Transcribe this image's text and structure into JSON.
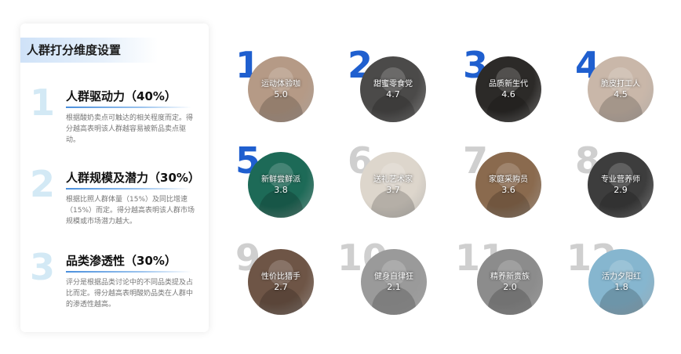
{
  "panel": {
    "title": "人群打分维度设置",
    "dimensions": [
      {
        "num": "1",
        "title": "人群驱动力（40%）",
        "desc": "根据酸奶卖点可触达的相关程度而定。得分越高表明该人群越容易被新品卖点驱动。"
      },
      {
        "num": "2",
        "title": "人群规模及潜力（30%）",
        "desc": "根据比照人群体量（15%）及同比增速（15%）而定。得分越高表明该人群市场规模或市场潜力越大。"
      },
      {
        "num": "3",
        "title": "品类渗透性（30%）",
        "desc": "评分是根据品类讨论中的不同品类提及占比而定。得分越高表明酸奶品类在人群中的渗透性越高。"
      }
    ]
  },
  "personas": [
    {
      "num": "1",
      "name": "运动体验咖",
      "score": "5.0",
      "highlight": true
    },
    {
      "num": "2",
      "name": "甜蜜零食党",
      "score": "4.7",
      "highlight": true
    },
    {
      "num": "3",
      "name": "品质新生代",
      "score": "4.6",
      "highlight": true
    },
    {
      "num": "4",
      "name": "脆皮打工人",
      "score": "4.5",
      "highlight": true
    },
    {
      "num": "5",
      "name": "新鲜尝鲜派",
      "score": "3.8",
      "highlight": true
    },
    {
      "num": "6",
      "name": "送礼艺术家",
      "score": "3.7",
      "highlight": false
    },
    {
      "num": "7",
      "name": "家庭采购员",
      "score": "3.6",
      "highlight": false
    },
    {
      "num": "8",
      "name": "专业营养师",
      "score": "2.9",
      "highlight": false
    },
    {
      "num": "9",
      "name": "性价比猎手",
      "score": "2.7",
      "highlight": false
    },
    {
      "num": "10",
      "name": "健身自律狂",
      "score": "2.1",
      "highlight": false
    },
    {
      "num": "11",
      "name": "精养新贵族",
      "score": "2.0",
      "highlight": false
    },
    {
      "num": "12",
      "name": "活力夕阳红",
      "score": "1.8",
      "highlight": false
    }
  ],
  "colors": {
    "highlight_number": "#1f5fcf",
    "muted_number": "#cfcfcf",
    "dimension_number": "#d3e9f5",
    "circle_fills": [
      "#b59a86",
      "#4b4a49",
      "#2c2a28",
      "#c9b7a9",
      "#1d6a57",
      "#ddd6cc",
      "#8a6a4e",
      "#3d3d3d",
      "#6e5546",
      "#9a9a9a",
      "#8c8c8c",
      "#86b6cf"
    ]
  }
}
